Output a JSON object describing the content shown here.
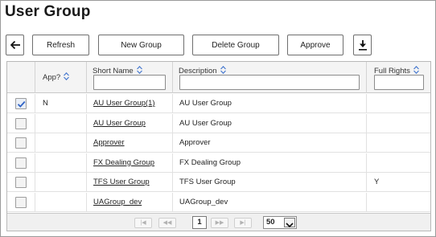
{
  "page": {
    "title": "User Group"
  },
  "toolbar": {
    "back_icon": "arrow-left-icon",
    "refresh_label": "Refresh",
    "new_group_label": "New Group",
    "delete_group_label": "Delete Group",
    "approve_label": "Approve",
    "download_icon": "download-icon"
  },
  "columns": {
    "app": "App?",
    "short_name": "Short Name",
    "description": "Description",
    "full_rights": "Full Rights"
  },
  "filters": {
    "short_name": "",
    "description": "",
    "full_rights": ""
  },
  "rows": [
    {
      "selected": true,
      "app": "N",
      "short_name": "AU User Group(1)",
      "description": "AU User Group",
      "full_rights": ""
    },
    {
      "selected": false,
      "app": "",
      "short_name": "AU User Group",
      "description": "AU User Group",
      "full_rights": ""
    },
    {
      "selected": false,
      "app": "",
      "short_name": "Approver",
      "description": "Approver",
      "full_rights": ""
    },
    {
      "selected": false,
      "app": "",
      "short_name": "FX Dealing Group",
      "description": "FX Dealing Group",
      "full_rights": ""
    },
    {
      "selected": false,
      "app": "",
      "short_name": "TFS User Group",
      "description": "TFS User Group",
      "full_rights": "Y"
    },
    {
      "selected": false,
      "app": "",
      "short_name": "UAGroup_dev",
      "description": "UAGroup_dev",
      "full_rights": ""
    }
  ],
  "pager": {
    "first": "|◀",
    "prev": "◀◀",
    "current_page": "1",
    "next": "▶▶",
    "last": "▶|",
    "page_size": "50"
  },
  "colors": {
    "border": "#6f6f6f",
    "header_bg": "#f4f4f4",
    "pager_bg": "#f0f0f0",
    "check_blue": "#2f63c5"
  }
}
